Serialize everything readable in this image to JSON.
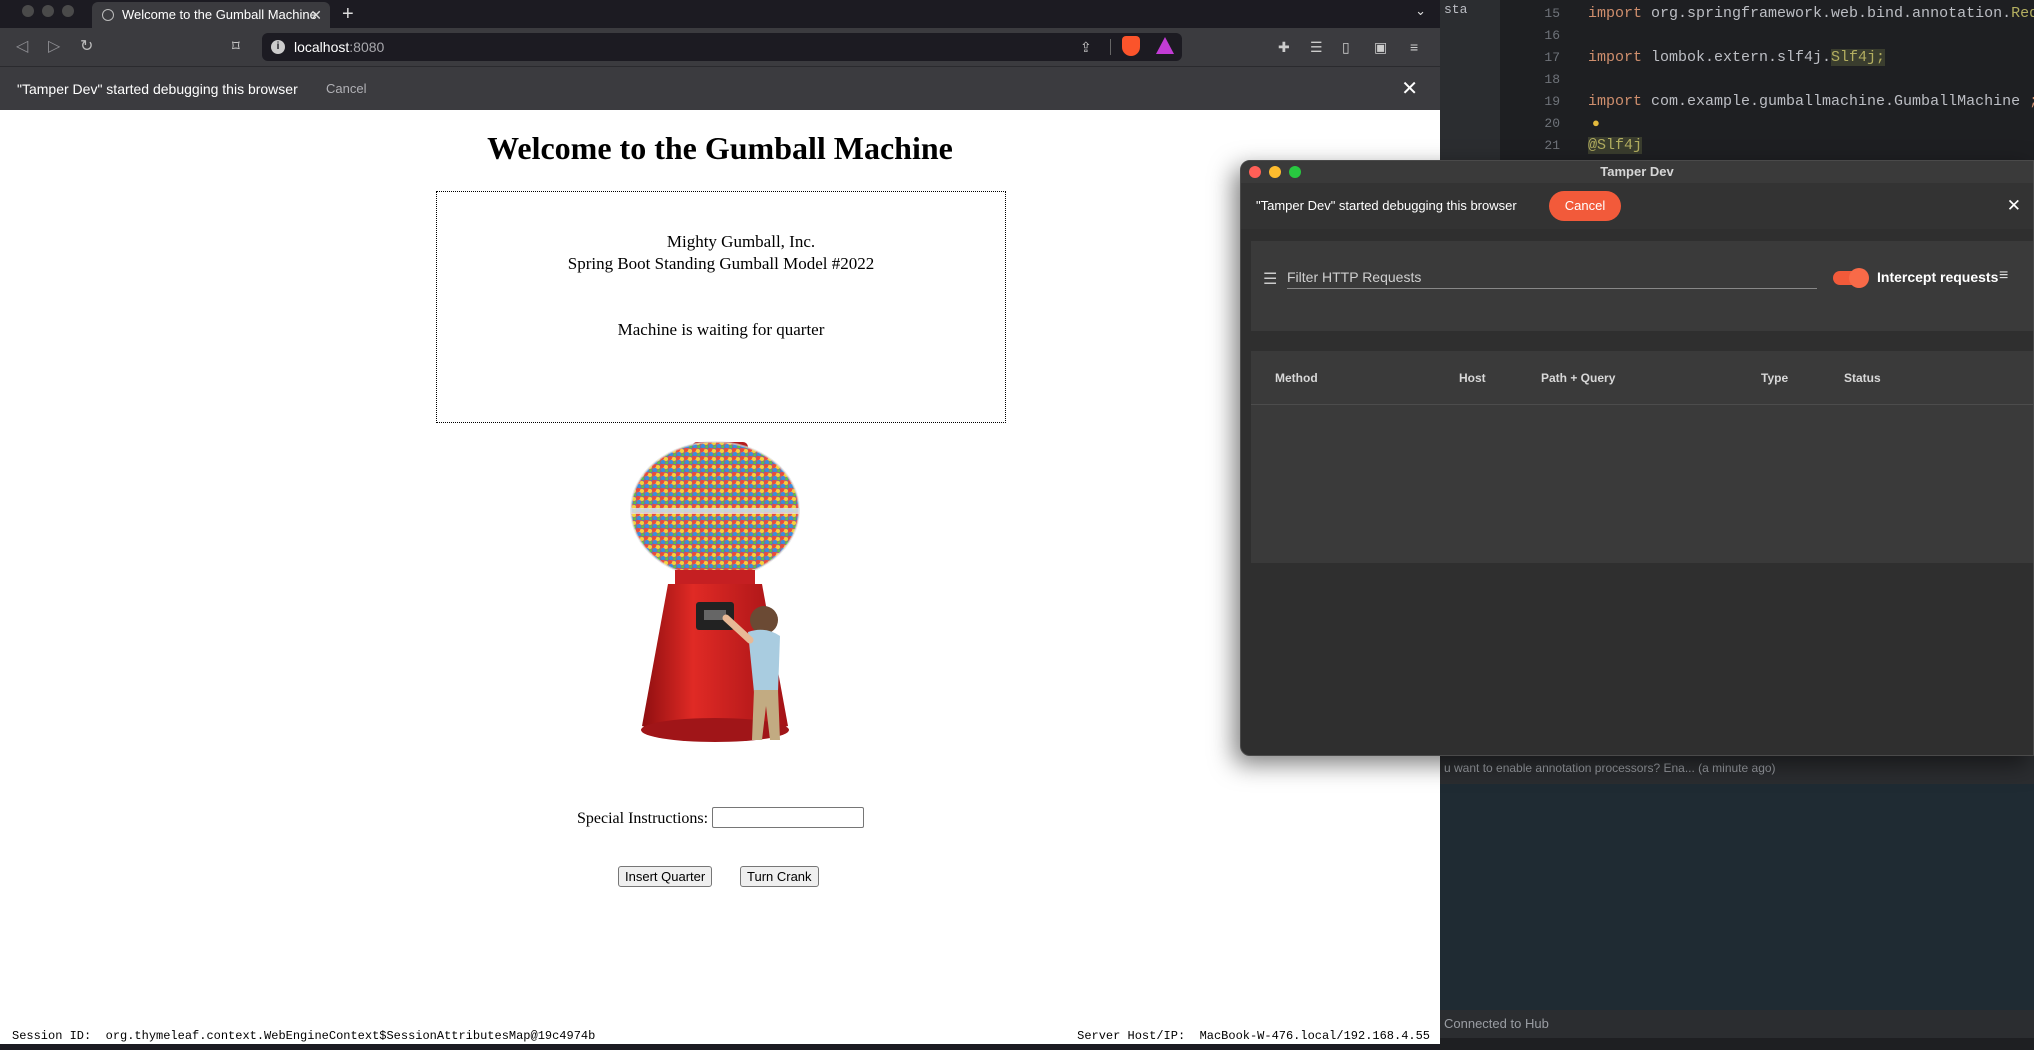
{
  "ide": {
    "top_left_fragment": "sta",
    "lines": [
      {
        "num": "15",
        "kw": "import",
        "rest": " org.springframework.web.bind.annotation.",
        "tail": "RequestPar"
      },
      {
        "num": "16",
        "kw": "",
        "rest": "",
        "tail": ""
      },
      {
        "num": "17",
        "kw": "import",
        "rest": " lombok.extern.slf4j.",
        "tail": "Slf4j;"
      },
      {
        "num": "18",
        "kw": "",
        "rest": "",
        "tail": ""
      },
      {
        "num": "19",
        "kw": "import",
        "rest": " com.example.gumballmachine.GumballMachine ",
        "tail": ";"
      },
      {
        "num": "20",
        "kw": "",
        "rest": "",
        "tail": ""
      },
      {
        "num": "21",
        "kw": "",
        "rest": "",
        "tail": "@Slf4j"
      }
    ],
    "status_hint": "u want to enable annotation processors? Ena... (a minute ago)",
    "status_bottom": "Connected to Hub"
  },
  "browser": {
    "tab_title": "Welcome to the Gumball Machine",
    "tab_close": "✕",
    "new_tab": "+",
    "url_host": "localhost",
    "url_port": ":8080",
    "infobar_message": "\"Tamper Dev\" started debugging this browser",
    "infobar_cancel": "Cancel",
    "infobar_close": "✕"
  },
  "page": {
    "heading": "Welcome to the Gumball Machine",
    "company": "Mighty Gumball, Inc.",
    "model": "Spring Boot Standing Gumball Model #2022",
    "machine_state": "Machine is waiting for quarter",
    "special_instructions_label": "Special Instructions:",
    "special_instructions_value": "",
    "insert_quarter": "Insert Quarter",
    "turn_crank": "Turn Crank",
    "session_label": "Session ID:",
    "session_value": "org.thymeleaf.context.WebEngineContext$SessionAttributesMap@19c4974b",
    "server_label": "Server Host/IP:",
    "server_value": "MacBook-W-476.local/192.168.4.55"
  },
  "tamper": {
    "window_title": "Tamper Dev",
    "infobar_message": "\"Tamper Dev\" started debugging this browser",
    "cancel_label": "Cancel",
    "close": "✕",
    "filter_placeholder": "Filter HTTP Requests",
    "intercept_label": "Intercept requests",
    "intercept_enabled": true,
    "columns": [
      "Method",
      "Host",
      "Path + Query",
      "Type",
      "Status"
    ],
    "rows": []
  },
  "colors": {
    "accent_orange": "#f25a3a",
    "browser_chrome": "#3b3b3f",
    "ide_keyword": "#cf8e6d"
  }
}
